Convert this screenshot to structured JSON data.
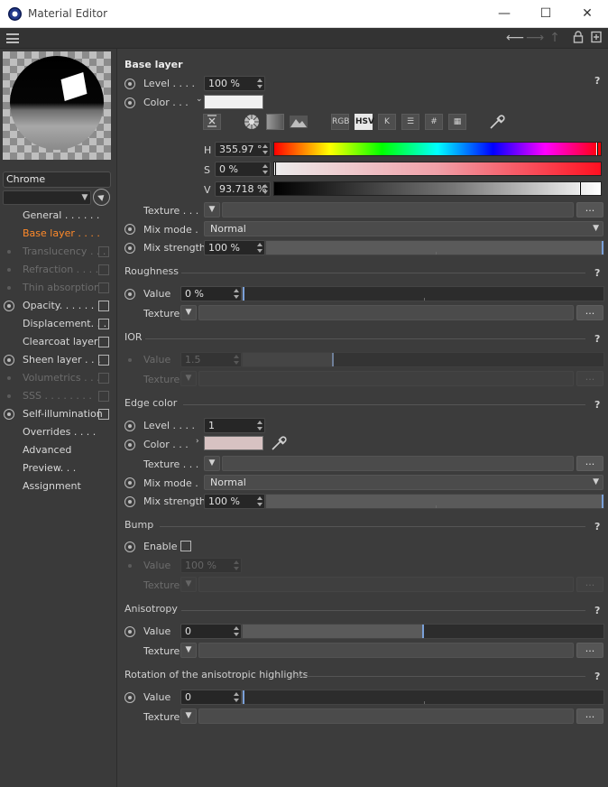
{
  "window": {
    "title": "Material Editor",
    "minimize": "—",
    "maximize": "☐",
    "close": "✕"
  },
  "toolbar": {
    "back_icon": "arrow-left-icon",
    "forward_icon": "arrow-right-icon",
    "up_icon": "arrow-up-icon",
    "lock_icon": "lock-icon",
    "new_icon": "new-window-icon"
  },
  "material": {
    "name": "Chrome",
    "preview_type": "chrome-sphere"
  },
  "nav": [
    {
      "label": "General . . . . . .",
      "marker": "none",
      "state": "normal",
      "checkbox": false
    },
    {
      "label": "Base layer . . . .",
      "marker": "none",
      "state": "active",
      "checkbox": false
    },
    {
      "label": "Translucency . . .",
      "marker": "dot",
      "state": "dim",
      "checkbox": true
    },
    {
      "label": "Refraction . . . .",
      "marker": "dot",
      "state": "dim",
      "checkbox": true
    },
    {
      "label": "Thin absorption",
      "marker": "dot",
      "state": "dim",
      "checkbox": true
    },
    {
      "label": "Opacity. . . . . .",
      "marker": "radio",
      "state": "normal",
      "checkbox": true
    },
    {
      "label": "Displacement. . .",
      "marker": "none",
      "state": "normal",
      "checkbox": true
    },
    {
      "label": "Clearcoat layer",
      "marker": "none",
      "state": "normal",
      "checkbox": true
    },
    {
      "label": "Sheen layer . . .",
      "marker": "radio",
      "state": "normal",
      "checkbox": true
    },
    {
      "label": "Volumetrics . . .",
      "marker": "dot",
      "state": "dim",
      "checkbox": true
    },
    {
      "label": "SSS . . . . . . . .",
      "marker": "dot",
      "state": "dim",
      "checkbox": true
    },
    {
      "label": "Self-illumination",
      "marker": "radio",
      "state": "normal",
      "checkbox": true
    },
    {
      "label": "Overrides . . . .",
      "marker": "none",
      "state": "normal",
      "checkbox": false
    },
    {
      "label": "Advanced",
      "marker": "none",
      "state": "normal",
      "checkbox": false
    },
    {
      "label": "Preview. . .",
      "marker": "none",
      "state": "normal",
      "checkbox": false
    },
    {
      "label": "Assignment",
      "marker": "none",
      "state": "normal",
      "checkbox": false
    }
  ],
  "base": {
    "title": "Base layer",
    "help": "?",
    "level_label": "Level . . . .",
    "level_value": "100 %",
    "color_label": "Color . . .",
    "color_hex": "#f2f2f2",
    "color_modes": [
      "RGB",
      "HSV",
      "K",
      "☰",
      "#",
      "▦"
    ],
    "active_mode": "HSV",
    "h_label": "H",
    "h_value": "355.97 °",
    "h_fraction": 0.989,
    "s_label": "S",
    "s_value": "0 %",
    "s_fraction": 0.0,
    "v_label": "V",
    "v_value": "93.718 %",
    "v_fraction": 0.937,
    "texture_label": "Texture . . .",
    "ellipsis": "...",
    "mix_mode_label": "Mix mode .",
    "mix_mode_value": "Normal",
    "mix_strength_label": "Mix strength",
    "mix_strength_value": "100 %",
    "mix_strength_fraction": 1.0
  },
  "roughness": {
    "title": "Roughness",
    "help": "?",
    "value_label": "Value",
    "value": "0 %",
    "fraction": 0.0,
    "texture_label": "Texture",
    "ellipsis": "..."
  },
  "ior": {
    "title": "IOR",
    "help": "?",
    "value_label": "Value",
    "value": "1.5",
    "fraction": 0.25,
    "texture_label": "Texture",
    "ellipsis": "..."
  },
  "edge": {
    "title": "Edge color",
    "help": "?",
    "level_label": "Level . . . .",
    "level_value": "1",
    "color_label": "Color . . .",
    "color_hex": "#d7c2c2",
    "texture_label": "Texture . . .",
    "ellipsis": "...",
    "mix_mode_label": "Mix mode .",
    "mix_mode_value": "Normal",
    "mix_strength_label": "Mix strength",
    "mix_strength_value": "100 %",
    "mix_strength_fraction": 1.0
  },
  "bump": {
    "title": "Bump",
    "help": "?",
    "enable_label": "Enable",
    "value_label": "Value",
    "value": "100 %",
    "texture_label": "Texture",
    "ellipsis": "..."
  },
  "anisotropy": {
    "title": "Anisotropy",
    "help": "?",
    "value_label": "Value",
    "value": "0",
    "fraction": 0.5,
    "texture_label": "Texture",
    "ellipsis": "..."
  },
  "rotation": {
    "title": "Rotation of the anisotropic highlights",
    "help": "?",
    "value_label": "Value",
    "value": "0",
    "fraction": 0.0,
    "texture_label": "Texture",
    "ellipsis": "..."
  }
}
